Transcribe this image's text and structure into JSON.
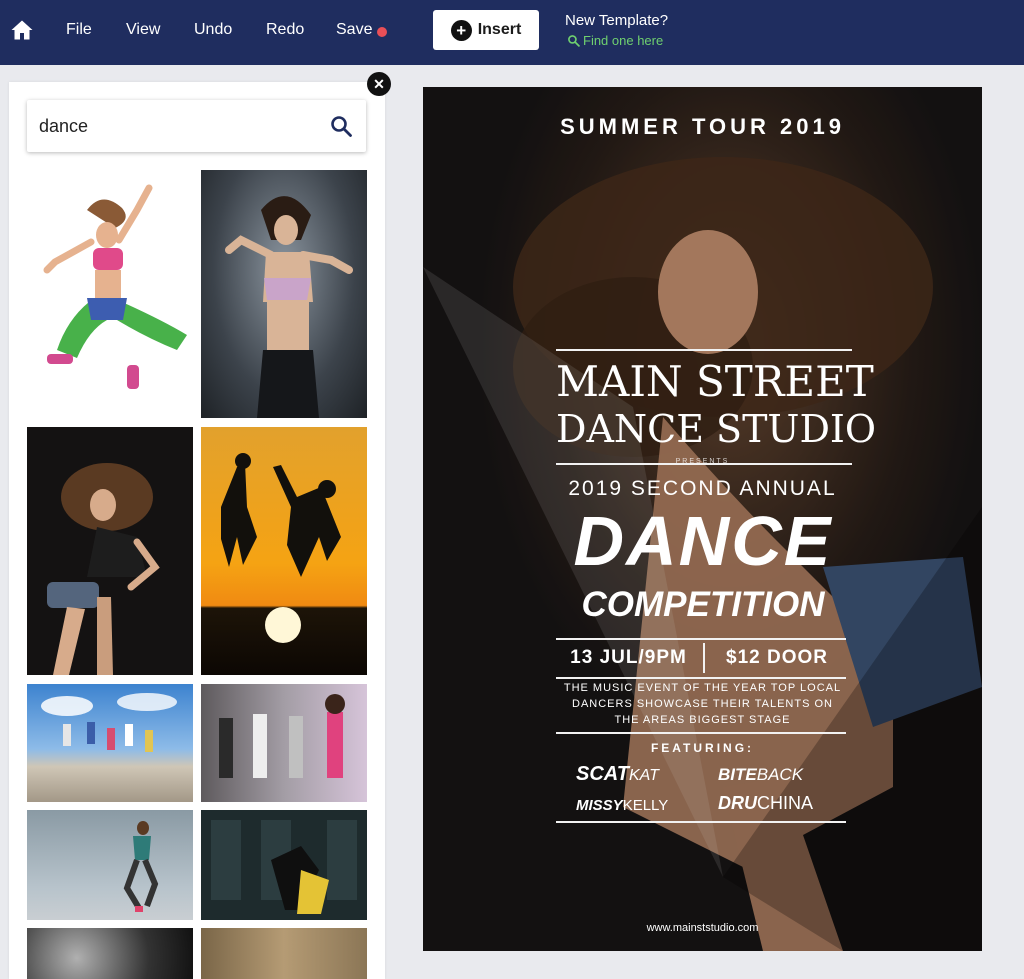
{
  "topbar": {
    "home_icon": "home-icon",
    "menu": {
      "file": "File",
      "view": "View",
      "undo": "Undo",
      "redo": "Redo",
      "save": "Save"
    },
    "save_status_color": "#e94f57",
    "insert_label": "Insert",
    "new_template_question": "New Template?",
    "find_link": "Find one here",
    "link_color": "#6fd06f",
    "bar_color": "#1f2d5f"
  },
  "search": {
    "value": "dance",
    "icon": "search-icon"
  },
  "results": {
    "thumbnails": [
      "dancer-jumping-green-pants",
      "dancer-pink-top-dark",
      "dancer-curly-hair",
      "silhouettes-sunset-jump",
      "group-jump-sky",
      "group-dance-studio",
      "dancer-jump-wall",
      "couple-dance-dark-room",
      "monochrome-texture",
      "sepia-texture"
    ]
  },
  "poster": {
    "tour": "SUMMER   TOUR   2019",
    "studio_line1": "MAIN STREET",
    "studio_line2": "DANCE STUDIO",
    "presents": "PRESENTS",
    "annual": "2019 SECOND ANNUAL",
    "dance": "DANCE",
    "competition": "COMPETITION",
    "date_time": "13 JUL/9PM",
    "price": "$12 DOOR",
    "desc_line1": "THE MUSIC EVENT OF THE YEAR TOP LOCAL",
    "desc_line2": "DANCERS SHOWCASE THEIR TALENTS  ON",
    "desc_line3": "THE   AREAS BIGGEST STAGE",
    "featuring": "FEATURING:",
    "performers": [
      {
        "a": "SCAT",
        "b": "KAT"
      },
      {
        "a": "BITE",
        "b": "BACK"
      },
      {
        "a": "MISSY",
        "b": "KELLY"
      },
      {
        "a": "DRU",
        "b": "CHINA"
      }
    ],
    "website": "www.mainststudio.com"
  }
}
